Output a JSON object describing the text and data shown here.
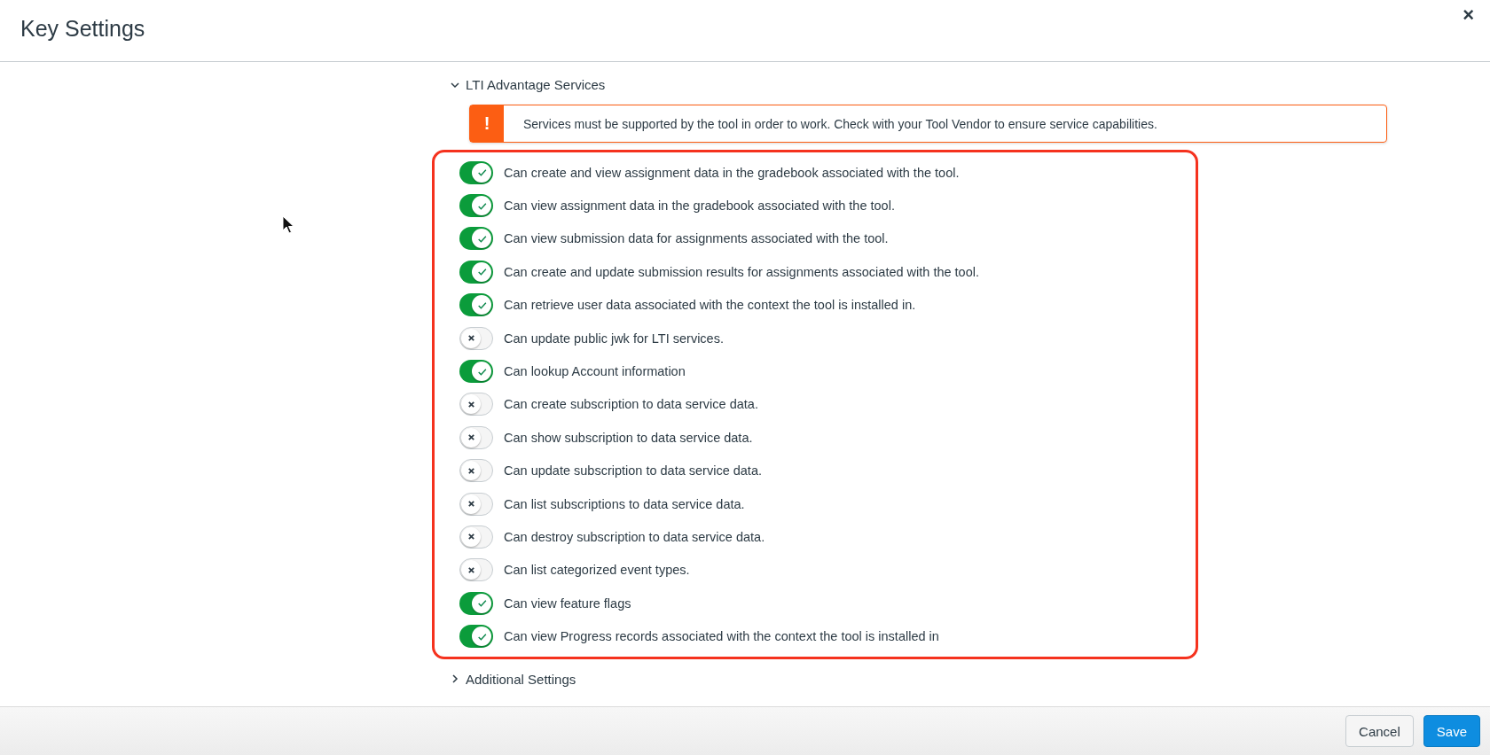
{
  "dialog": {
    "title": "Key Settings",
    "close": "×"
  },
  "lti_section": {
    "title": "LTI Advantage Services",
    "expanded": true
  },
  "alert": {
    "icon": "!",
    "text": "Services must be supported by the tool in order to work. Check with your Tool Vendor to ensure service capabilities."
  },
  "services": [
    {
      "label": "Can create and view assignment data in the gradebook associated with the tool.",
      "on": true
    },
    {
      "label": "Can view assignment data in the gradebook associated with the tool.",
      "on": true
    },
    {
      "label": "Can view submission data for assignments associated with the tool.",
      "on": true
    },
    {
      "label": "Can create and update submission results for assignments associated with the tool.",
      "on": true
    },
    {
      "label": "Can retrieve user data associated with the context the tool is installed in.",
      "on": true
    },
    {
      "label": "Can update public jwk for LTI services.",
      "on": false
    },
    {
      "label": "Can lookup Account information",
      "on": true
    },
    {
      "label": "Can create subscription to data service data.",
      "on": false
    },
    {
      "label": "Can show subscription to data service data.",
      "on": false
    },
    {
      "label": "Can update subscription to data service data.",
      "on": false
    },
    {
      "label": "Can list subscriptions to data service data.",
      "on": false
    },
    {
      "label": "Can destroy subscription to data service data.",
      "on": false
    },
    {
      "label": "Can list categorized event types.",
      "on": false
    },
    {
      "label": "Can view feature flags",
      "on": true
    },
    {
      "label": "Can view Progress records associated with the context the tool is installed in",
      "on": true
    }
  ],
  "additional_section": {
    "title": "Additional Settings",
    "expanded": false
  },
  "footer": {
    "buttons": [
      {
        "label": "Cancel",
        "kind": "secondary"
      },
      {
        "label": "Save",
        "kind": "primary"
      }
    ]
  }
}
